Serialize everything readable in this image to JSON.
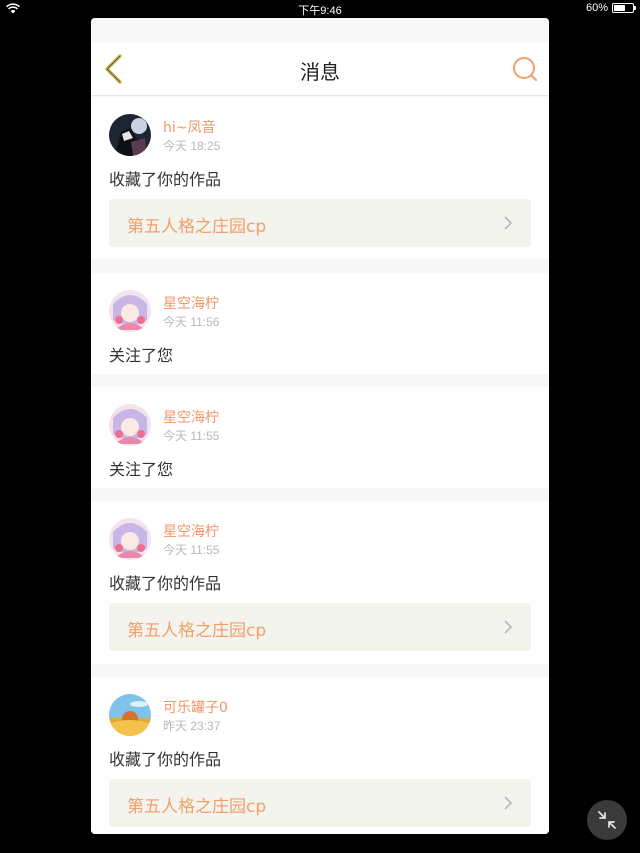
{
  "status_bar": {
    "time": "下午9:46",
    "battery": "60%",
    "battery_level": 0.6
  },
  "nav": {
    "title": "消息"
  },
  "messages": [
    {
      "username": "hi~凤音",
      "time": "今天 18:25",
      "action": "收藏了你的作品",
      "work": "第五人格之庄园cp",
      "avatar": "dark"
    },
    {
      "username": "星空海柠",
      "time": "今天 11:56",
      "action": "关注了您",
      "avatar": "pink"
    },
    {
      "username": "星空海柠",
      "time": "今天 11:55",
      "action": "关注了您",
      "avatar": "pink"
    },
    {
      "username": "星空海柠",
      "time": "今天 11:55",
      "action": "收藏了你的作品",
      "work": "第五人格之庄园cp",
      "avatar": "pink"
    },
    {
      "username": "可乐罐子0",
      "time": "昨天 23:37",
      "action": "收藏了你的作品",
      "work": "第五人格之庄园cp",
      "avatar": "sky"
    }
  ],
  "icons": {
    "back": "chevron-left-icon",
    "search": "search-icon",
    "work_link": "chevron-right-icon",
    "fab": "collapse-arrows-icon"
  },
  "colors": {
    "accent": "#f2966a",
    "back_icon": "#d8b54a",
    "work_bg": "#f4f4ee"
  }
}
